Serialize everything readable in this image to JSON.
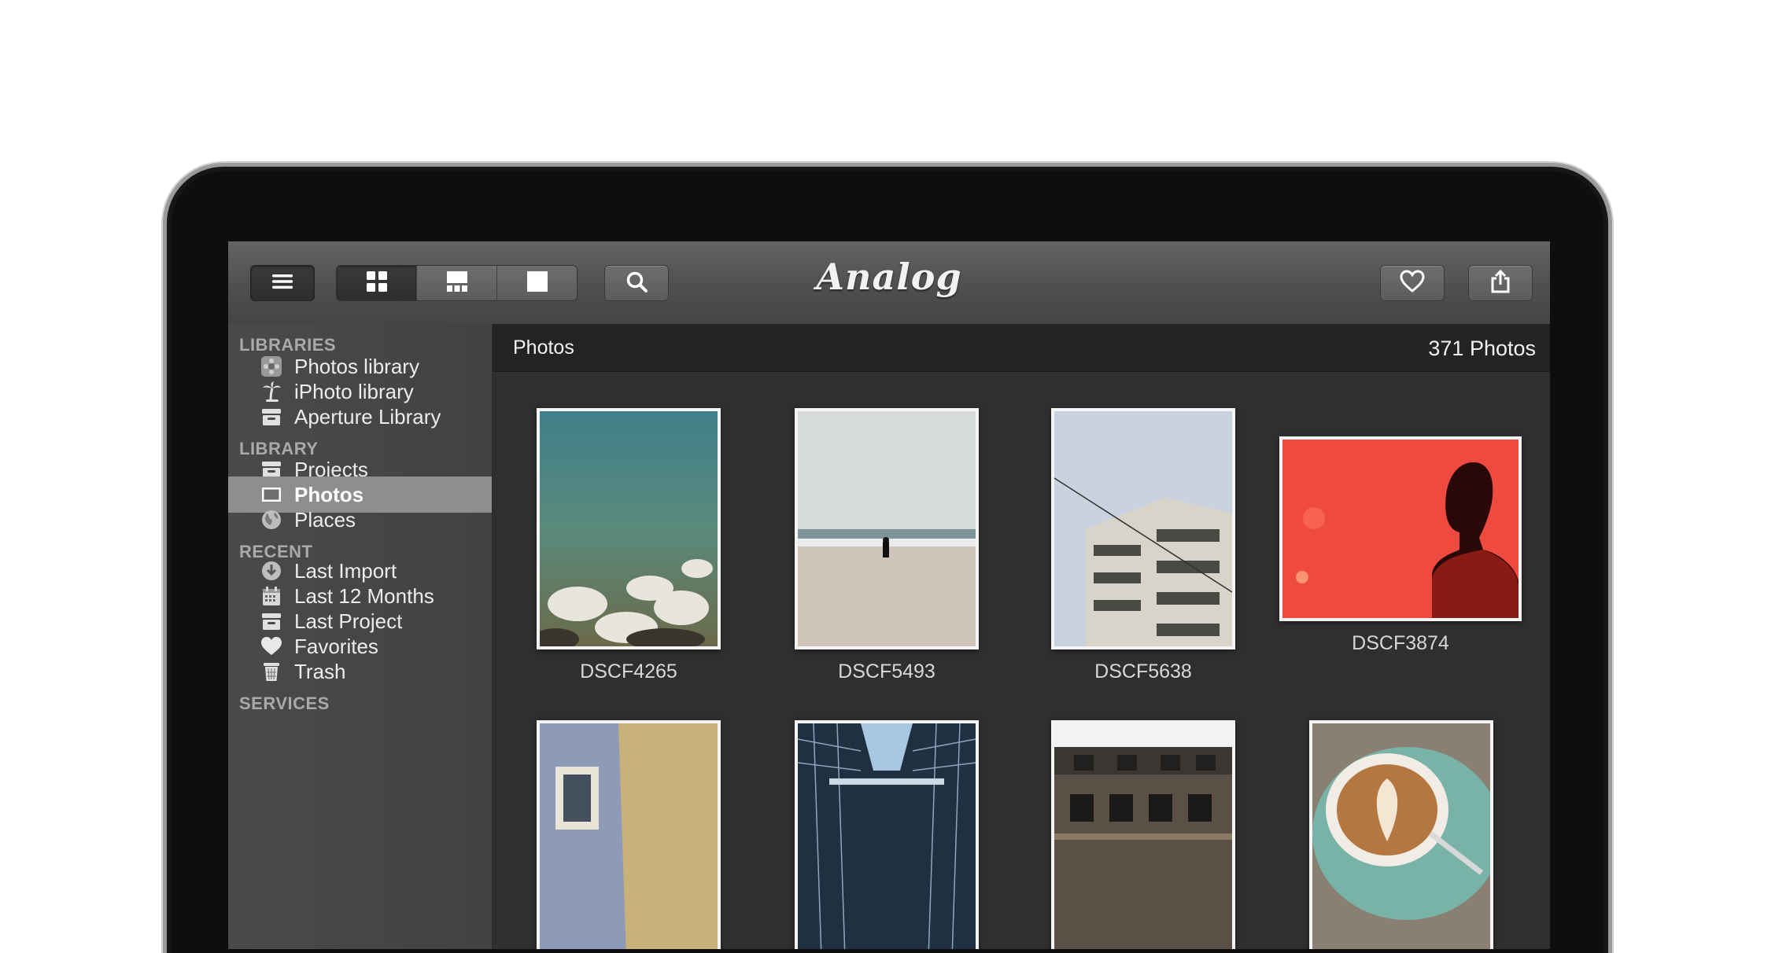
{
  "app": {
    "logo_text": "Analog"
  },
  "toolbar": {
    "menu_icon": "hamburger-icon",
    "view_modes": [
      "grid-view-icon",
      "mosaic-view-icon",
      "single-view-icon"
    ],
    "search_icon": "search-icon",
    "favorite_icon": "heart-icon",
    "share_icon": "share-icon"
  },
  "sidebar": {
    "sections": [
      {
        "heading": "LIBRARIES",
        "items": [
          {
            "label": "Photos library",
            "icon": "photos-app-icon"
          },
          {
            "label": "iPhoto library",
            "icon": "palm-tree-icon"
          },
          {
            "label": "Aperture Library",
            "icon": "archive-box-icon"
          }
        ]
      },
      {
        "heading": "LIBRARY",
        "items": [
          {
            "label": "Projects",
            "icon": "archive-box-icon"
          },
          {
            "label": "Photos",
            "icon": "photo-frame-icon",
            "selected": true
          },
          {
            "label": "Places",
            "icon": "globe-icon"
          }
        ]
      },
      {
        "heading": "RECENT",
        "items": [
          {
            "label": "Last Import",
            "icon": "import-icon"
          },
          {
            "label": "Last 12 Months",
            "icon": "calendar-icon"
          },
          {
            "label": "Last Project",
            "icon": "archive-box-icon"
          },
          {
            "label": "Favorites",
            "icon": "heart-icon"
          },
          {
            "label": "Trash",
            "icon": "trash-icon"
          }
        ]
      },
      {
        "heading": "SERVICES",
        "items": []
      }
    ]
  },
  "content": {
    "title": "Photos",
    "count_label": "371 Photos",
    "photos": [
      {
        "name": "DSCF4265"
      },
      {
        "name": "DSCF5493"
      },
      {
        "name": "DSCF5638"
      },
      {
        "name": "DSCF3874"
      },
      {
        "name": ""
      },
      {
        "name": ""
      },
      {
        "name": ""
      },
      {
        "name": ""
      }
    ]
  }
}
